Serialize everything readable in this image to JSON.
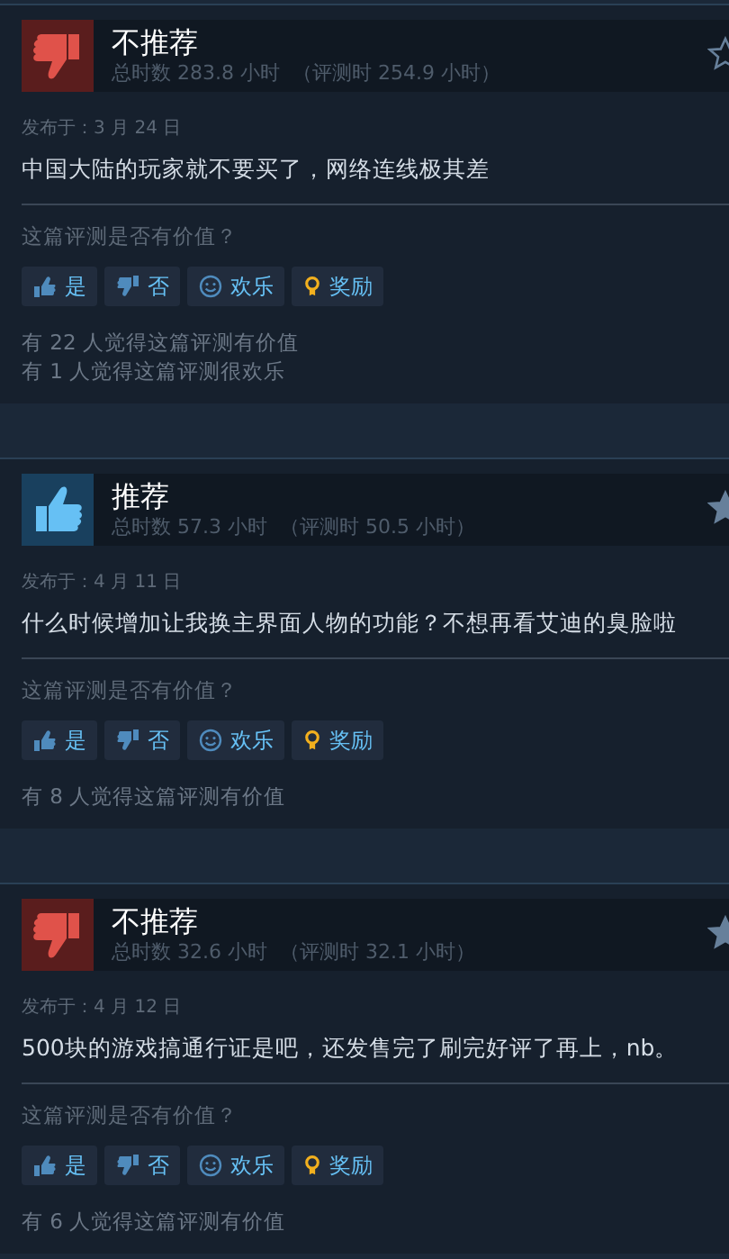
{
  "reviews": [
    {
      "recommended": false,
      "title": "不推荐",
      "hours": "总时数 283.8 小时",
      "review_hours": "（评测时 254.9 小时）",
      "star_filled": false,
      "date": "发布于：3 月 24 日",
      "text": "中国大陆的玩家就不要买了，网络连线极其差",
      "question": "这篇评测是否有价值？",
      "buttons": [
        {
          "kind": "yes",
          "label": "是"
        },
        {
          "kind": "no",
          "label": "否"
        },
        {
          "kind": "funny",
          "label": "欢乐"
        },
        {
          "kind": "award",
          "label": "奖励"
        }
      ],
      "counts": [
        "有 22 人觉得这篇评测有价值",
        "有 1 人觉得这篇评测很欢乐"
      ]
    },
    {
      "recommended": true,
      "title": "推荐",
      "hours": "总时数 57.3 小时",
      "review_hours": "（评测时 50.5 小时）",
      "star_filled": true,
      "date": "发布于：4 月 11 日",
      "text": "什么时候增加让我换主界面人物的功能？不想再看艾迪的臭脸啦",
      "question": "这篇评测是否有价值？",
      "buttons": [
        {
          "kind": "yes",
          "label": "是"
        },
        {
          "kind": "no",
          "label": "否"
        },
        {
          "kind": "funny",
          "label": "欢乐"
        },
        {
          "kind": "award",
          "label": "奖励"
        }
      ],
      "counts": [
        "有 8 人觉得这篇评测有价值"
      ]
    },
    {
      "recommended": false,
      "title": "不推荐",
      "hours": "总时数 32.6 小时",
      "review_hours": "（评测时 32.1 小时）",
      "star_filled": true,
      "date": "发布于：4 月 12 日",
      "text": "500块的游戏搞通行证是吧，还发售完了刷完好评了再上，nb。",
      "question": "这篇评测是否有价值？",
      "buttons": [
        {
          "kind": "yes",
          "label": "是"
        },
        {
          "kind": "no",
          "label": "否"
        },
        {
          "kind": "funny",
          "label": "欢乐"
        },
        {
          "kind": "award",
          "label": "奖励"
        }
      ],
      "counts": [
        "有 6 人觉得这篇评测有价值"
      ]
    }
  ]
}
